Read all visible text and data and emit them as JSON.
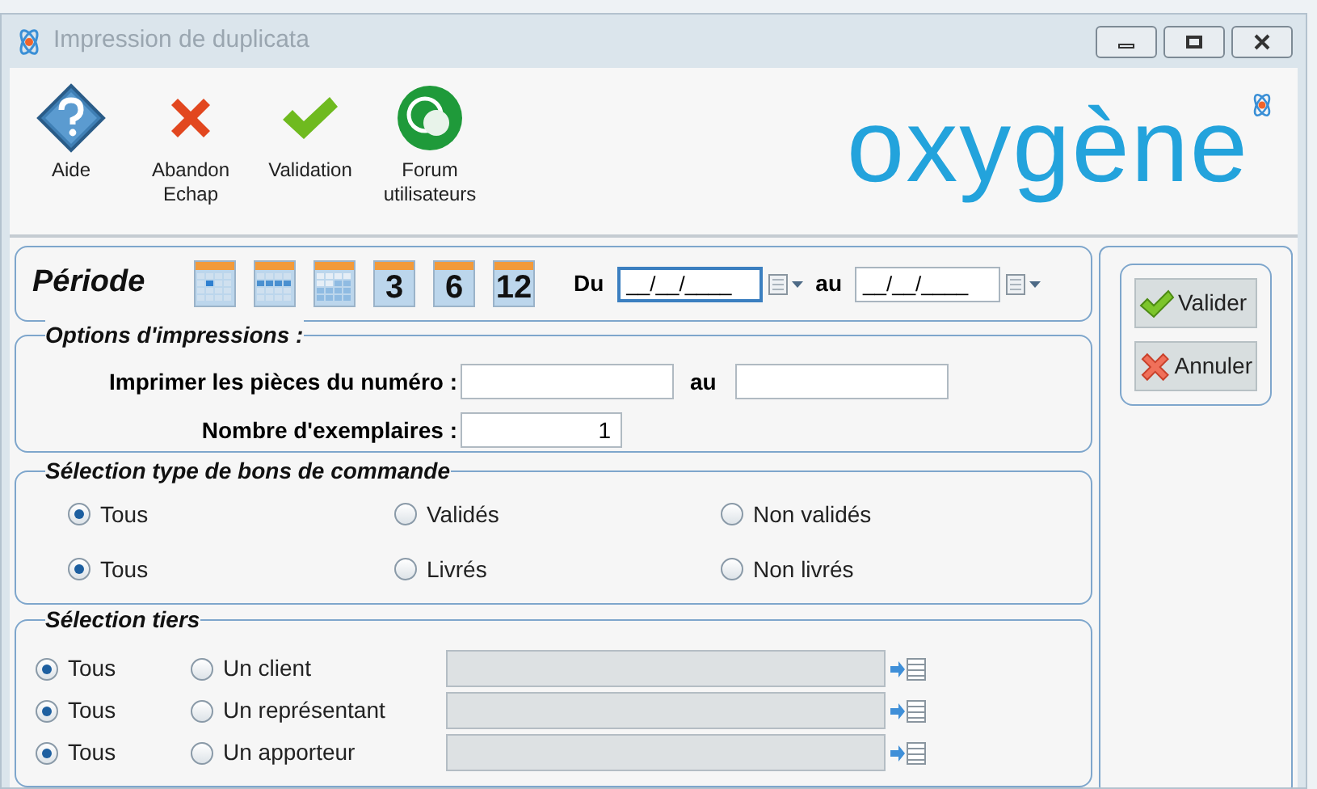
{
  "window": {
    "title": "Impression de duplicata"
  },
  "toolbar": [
    {
      "kind": "help",
      "label": "Aide"
    },
    {
      "kind": "cancel",
      "label": "Abandon\nEchap"
    },
    {
      "kind": "validate",
      "label": "Validation"
    },
    {
      "kind": "forum",
      "label": "Forum\nutilisateurs"
    }
  ],
  "logo": {
    "text": "oxygène"
  },
  "periode": {
    "title": "Période",
    "presets": [
      {
        "kind": "day"
      },
      {
        "kind": "week"
      },
      {
        "kind": "month"
      },
      {
        "kind": "number",
        "label": "3"
      },
      {
        "kind": "number",
        "label": "6"
      },
      {
        "kind": "number",
        "label": "12"
      }
    ],
    "from_label": "Du",
    "from_value": "__/__/____",
    "from_focused": true,
    "to_label": "au",
    "to_value": "__/__/____",
    "to_focused": false
  },
  "options": {
    "title": "Options d'impressions :",
    "numero_label": "Imprimer les pièces du numéro :",
    "numero_to_label": "au",
    "copies_label": "Nombre d'exemplaires :",
    "copies_value": "1"
  },
  "type_selection": {
    "title": "Sélection type de bons de commande",
    "rows": [
      [
        {
          "label": "Tous",
          "selected": true
        },
        {
          "label": "Validés",
          "selected": false
        },
        {
          "label": "Non validés",
          "selected": false
        }
      ],
      [
        {
          "label": "Tous",
          "selected": true
        },
        {
          "label": "Livrés",
          "selected": false
        },
        {
          "label": "Non livrés",
          "selected": false
        }
      ]
    ]
  },
  "tiers": {
    "title": "Sélection tiers",
    "rows": [
      {
        "all_label": "Tous",
        "all_selected": true,
        "one_label": "Un client",
        "one_selected": false
      },
      {
        "all_label": "Tous",
        "all_selected": true,
        "one_label": "Un représentant",
        "one_selected": false
      },
      {
        "all_label": "Tous",
        "all_selected": true,
        "one_label": "Un apporteur",
        "one_selected": false
      }
    ]
  },
  "actions": [
    {
      "kind": "ok",
      "label": "Valider"
    },
    {
      "kind": "cancel",
      "label": "Annuler"
    }
  ]
}
